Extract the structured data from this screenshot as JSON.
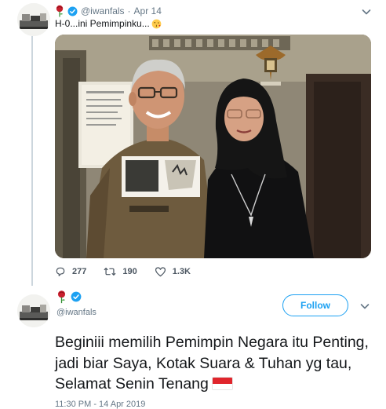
{
  "parent_tweet": {
    "handle": "@iwanfals",
    "separator": "·",
    "date": "Apr 14",
    "text": "H-0...ini Pemimpinku...",
    "icons": [
      "avatar",
      "rose-icon",
      "verified-badge-icon",
      "kiss-emoji-icon",
      "chevron-down-icon"
    ],
    "actions": {
      "replies": "277",
      "retweets": "190",
      "likes": "1.3K"
    }
  },
  "main_tweet": {
    "handle": "@iwanfals",
    "follow_label": "Follow",
    "text": "Beginiii memilih Pemimpin Negara itu Penting, jadi biar Saya, Kotak Suara & Tuhan yg tau, Selamat Senin Tenang",
    "timestamp": "11:30 PM - 14 Apr 2019",
    "icons": [
      "avatar",
      "rose-icon",
      "verified-badge-icon",
      "indonesia-flag-icon",
      "chevron-down-icon"
    ]
  },
  "colors": {
    "accent": "#1da1f2",
    "muted_text": "#657786",
    "primary_text": "#14171a",
    "thread_line": "#ccd6dd",
    "flag_red": "#e0252c"
  }
}
